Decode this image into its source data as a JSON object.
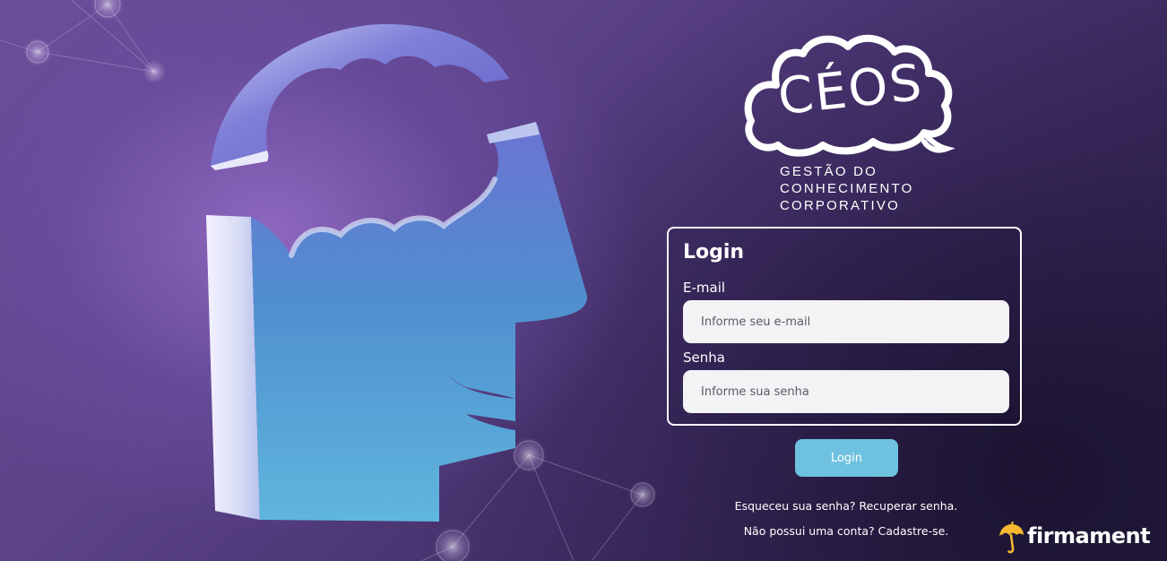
{
  "logo": {
    "wordmark": "CÉOS",
    "tagline": [
      "GESTÃO DO",
      "CONHECIMENTO",
      "CORPORATIVO"
    ]
  },
  "login": {
    "title": "Login",
    "email_label": "E-mail",
    "email_placeholder": "Informe seu e-mail",
    "email_value": "",
    "password_label": "Senha",
    "password_placeholder": "Informe sua senha",
    "password_value": "",
    "submit_label": "Login"
  },
  "links": {
    "forgot_prompt": "Esqueceu sua senha?",
    "forgot_link": "Recuperar senha.",
    "signup_prompt": "Não possui uma conta?",
    "signup_link": "Cadastre-se."
  },
  "brand": {
    "name": "firmament",
    "icon": "umbrella-icon"
  },
  "colors": {
    "accent": "#6ec2df",
    "brand_yellow": "#f4b731",
    "head_blue": "#5aa7d8",
    "head_violet": "#6e66c8"
  }
}
